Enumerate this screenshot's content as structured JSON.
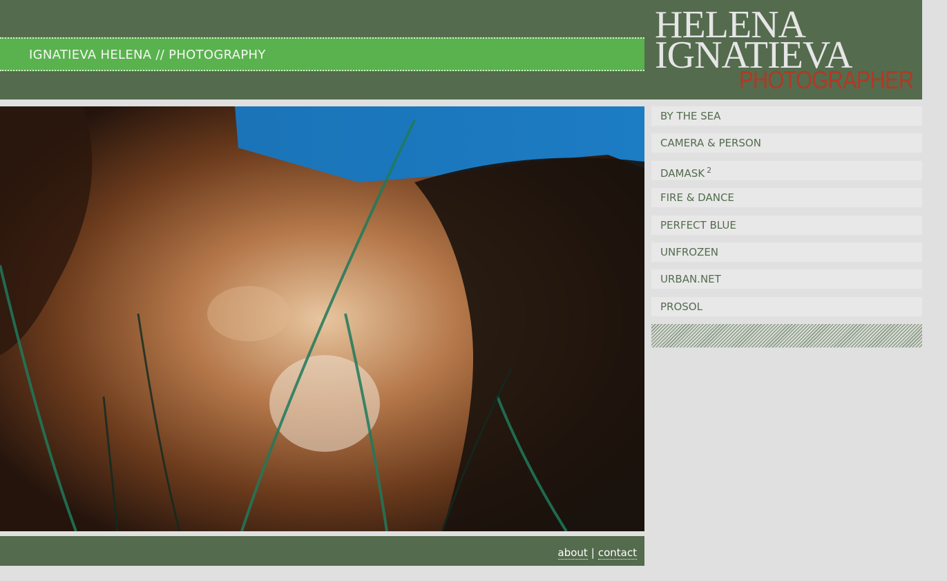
{
  "header": {
    "site_title": "IGNATIEVA HELENA // PHOTOGRAPHY",
    "logo_line1": "HELENA",
    "logo_line2": "IGNATIEVA",
    "logo_line3": "PHOTOGRAPHER"
  },
  "nav": {
    "items": [
      {
        "label": "BY THE SEA"
      },
      {
        "label": "CAMERA & PERSON"
      },
      {
        "label": "DAMASK",
        "superscript": "2"
      },
      {
        "label": "FIRE & DANCE"
      },
      {
        "label": "PERFECT BLUE"
      },
      {
        "label": "UNFROZEN"
      },
      {
        "label": "URBAN.NET"
      },
      {
        "label": "PROSOL"
      }
    ]
  },
  "footer": {
    "about_label": "about",
    "separator": "|",
    "contact_label": "contact"
  },
  "colors": {
    "header_bg": "#546b4e",
    "title_bar": "#5ab24f",
    "nav_text": "#546b4e",
    "logo_accent": "#b03a22"
  }
}
